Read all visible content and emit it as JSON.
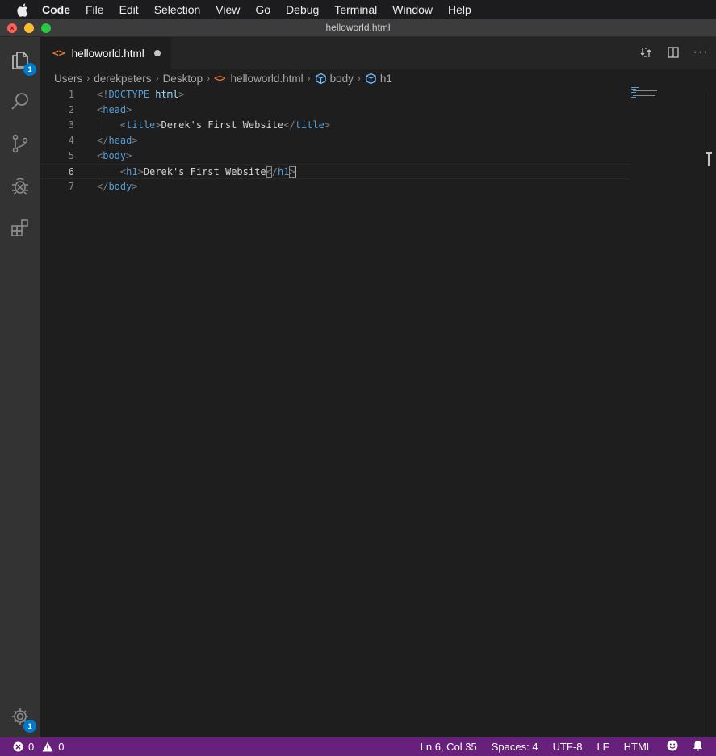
{
  "menubar": {
    "items": [
      {
        "label": "Code",
        "bold": true
      },
      {
        "label": "File"
      },
      {
        "label": "Edit"
      },
      {
        "label": "Selection"
      },
      {
        "label": "View"
      },
      {
        "label": "Go"
      },
      {
        "label": "Debug"
      },
      {
        "label": "Terminal"
      },
      {
        "label": "Window"
      },
      {
        "label": "Help"
      }
    ]
  },
  "window": {
    "title": "helloworld.html"
  },
  "activity": {
    "explorer_badge": "1",
    "settings_badge": "1"
  },
  "tab": {
    "name": "helloworld.html",
    "dirty": true
  },
  "breadcrumb": {
    "parts": [
      "Users",
      "derekpeters",
      "Desktop",
      "helloworld.html",
      "body",
      "h1"
    ]
  },
  "editor": {
    "line_numbers": [
      "1",
      "2",
      "3",
      "4",
      "5",
      "6",
      "7"
    ],
    "active_line": 6,
    "lines": [
      [
        {
          "t": "<!",
          "c": "punc"
        },
        {
          "t": "DOCTYPE",
          "c": "doc"
        },
        {
          "t": " ",
          "c": "text"
        },
        {
          "t": "html",
          "c": "kw"
        },
        {
          "t": ">",
          "c": "punc"
        }
      ],
      [
        {
          "t": "<",
          "c": "punc"
        },
        {
          "t": "head",
          "c": "tag"
        },
        {
          "t": ">",
          "c": "punc"
        }
      ],
      [
        {
          "t": "    ",
          "c": "text"
        },
        {
          "t": "<",
          "c": "punc"
        },
        {
          "t": "title",
          "c": "tag"
        },
        {
          "t": ">",
          "c": "punc"
        },
        {
          "t": "Derek's First Website",
          "c": "text"
        },
        {
          "t": "</",
          "c": "punc"
        },
        {
          "t": "title",
          "c": "tag"
        },
        {
          "t": ">",
          "c": "punc"
        }
      ],
      [
        {
          "t": "</",
          "c": "punc"
        },
        {
          "t": "head",
          "c": "tag"
        },
        {
          "t": ">",
          "c": "punc"
        }
      ],
      [
        {
          "t": "<",
          "c": "punc"
        },
        {
          "t": "body",
          "c": "tag"
        },
        {
          "t": ">",
          "c": "punc"
        }
      ],
      [
        {
          "t": "    ",
          "c": "text"
        },
        {
          "t": "<",
          "c": "punc"
        },
        {
          "t": "h1",
          "c": "tag"
        },
        {
          "t": ">",
          "c": "punc"
        },
        {
          "t": "Derek's First Website",
          "c": "text"
        },
        {
          "t": "<",
          "c": "punc",
          "bm": true
        },
        {
          "t": "/",
          "c": "punc"
        },
        {
          "t": "h1",
          "c": "tag"
        },
        {
          "t": ">",
          "c": "punc",
          "bm": true
        }
      ],
      [
        {
          "t": "</",
          "c": "punc"
        },
        {
          "t": "body",
          "c": "tag"
        },
        {
          "t": ">",
          "c": "punc"
        }
      ]
    ]
  },
  "status": {
    "errors": "0",
    "warnings": "0",
    "position": "Ln 6, Col 35",
    "spaces": "Spaces: 4",
    "encoding": "UTF-8",
    "eol": "LF",
    "language": "HTML"
  },
  "colors": {
    "status_bar": "#68217a",
    "badge": "#007acc",
    "tag": "#569cd6",
    "html_icon": "#e37933"
  }
}
